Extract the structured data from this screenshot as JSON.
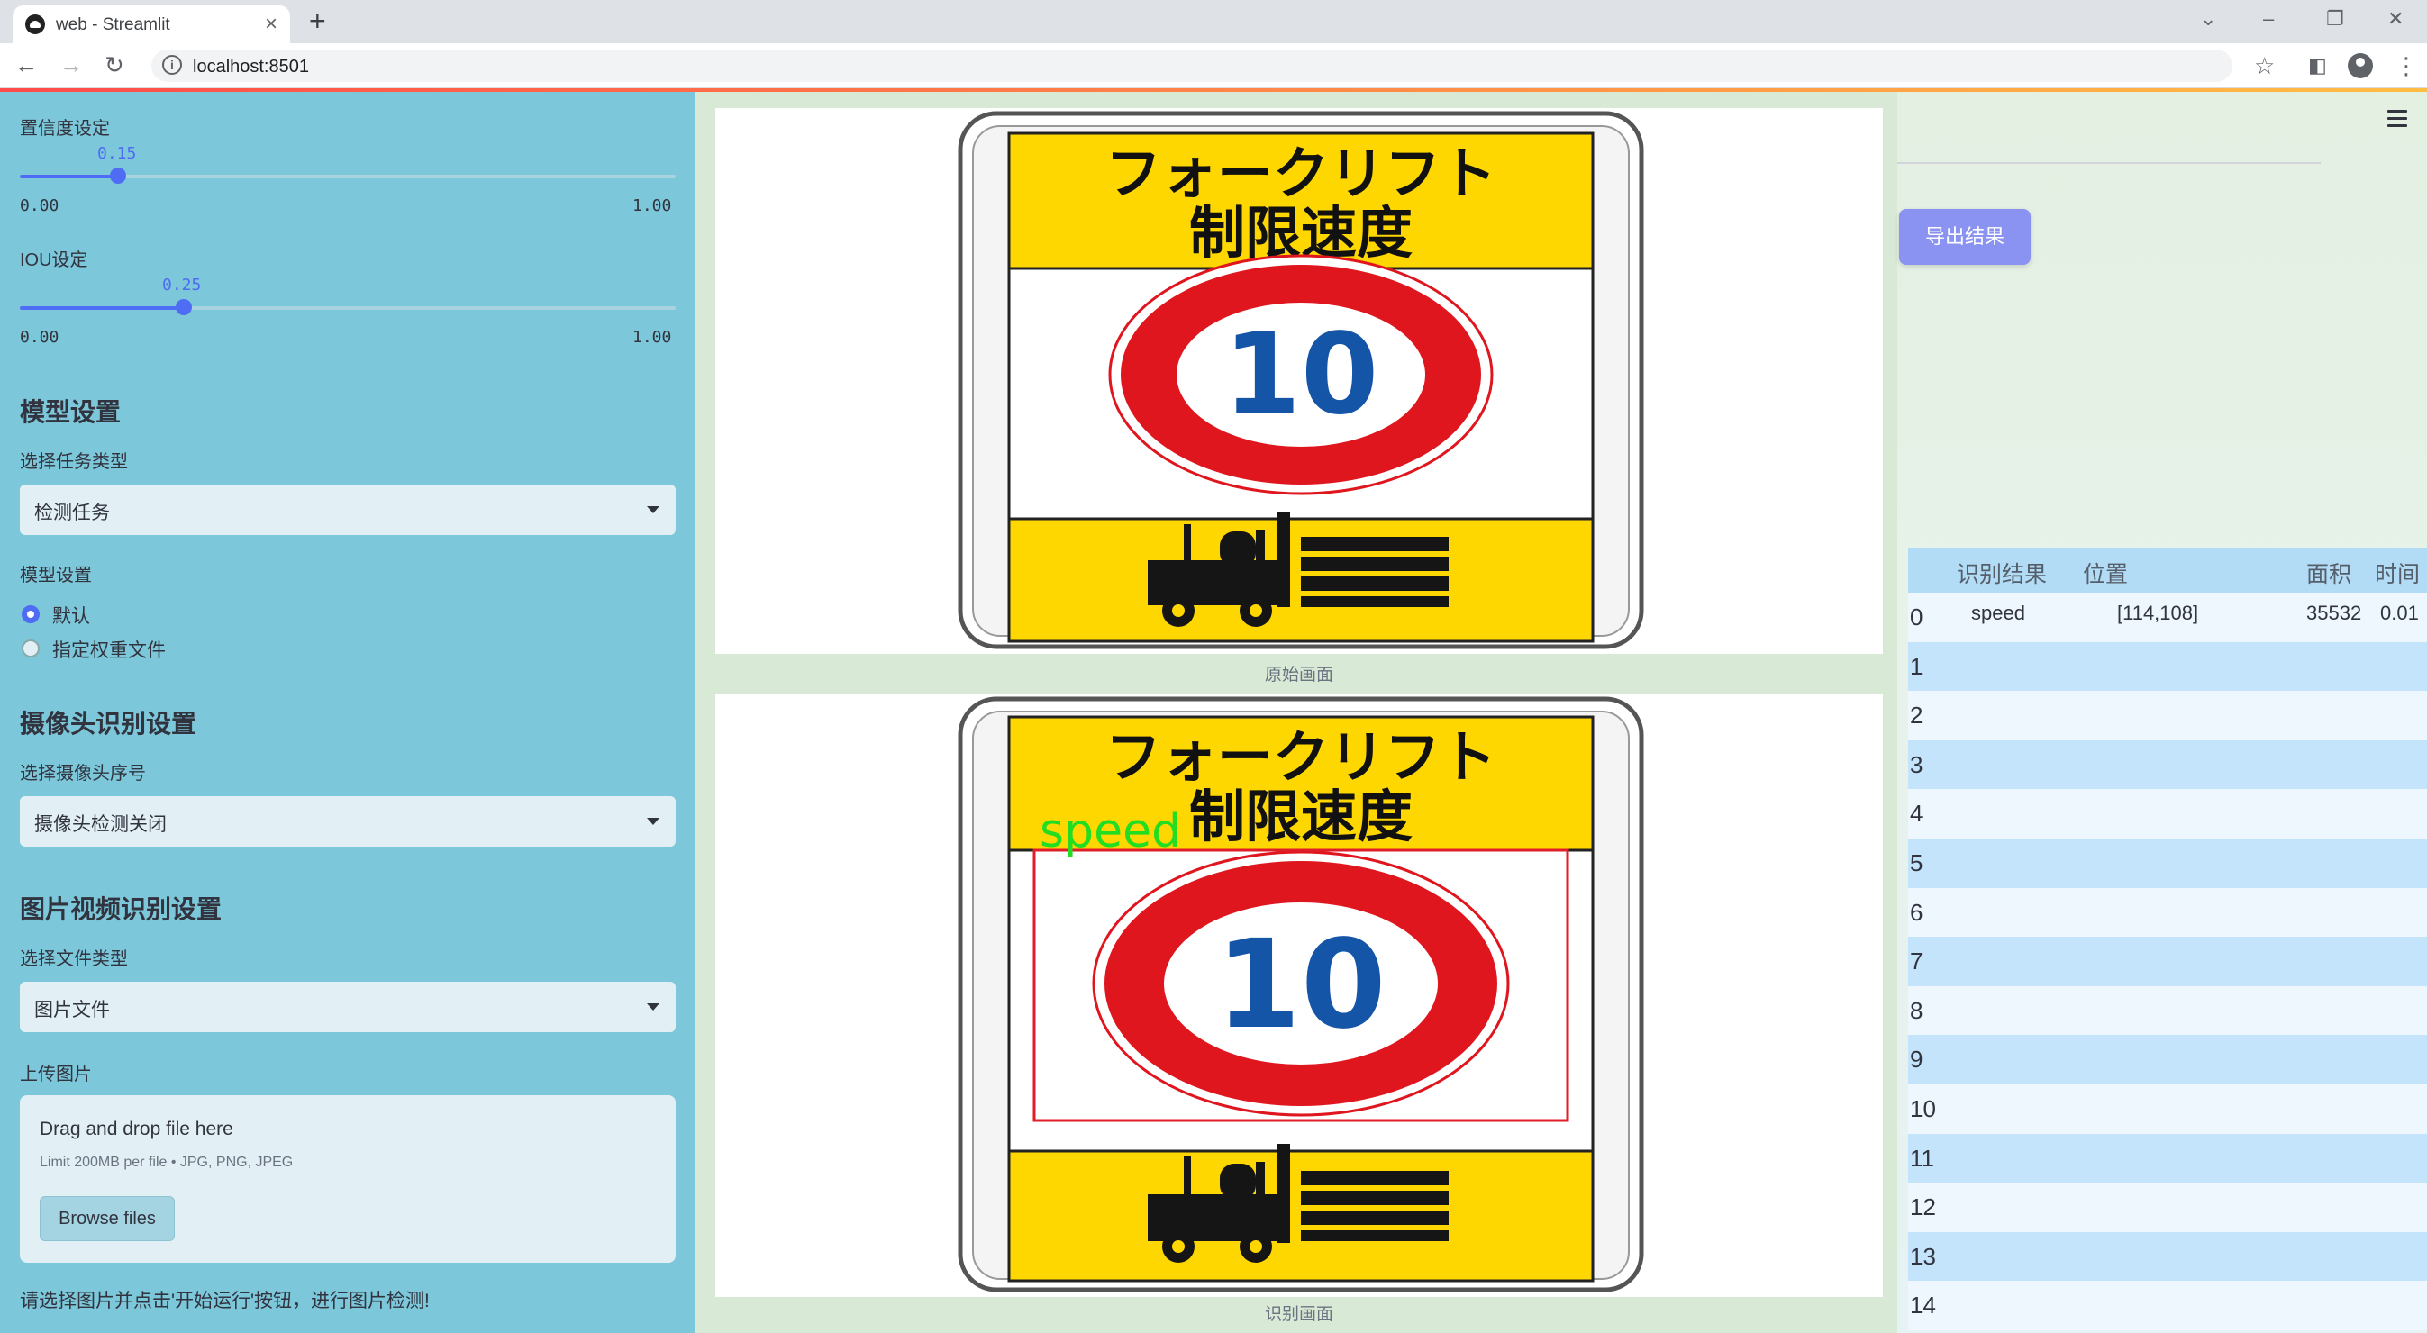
{
  "browser": {
    "tab_title": "web - Streamlit",
    "url": "localhost:8501"
  },
  "sidebar": {
    "confidence_label": "置信度设定",
    "confidence_value": "0.15",
    "confidence_min": "0.00",
    "confidence_max": "1.00",
    "confidence_fraction": 0.15,
    "iou_label": "IOU设定",
    "iou_value": "0.25",
    "iou_min": "0.00",
    "iou_max": "1.00",
    "iou_fraction": 0.25,
    "model_header": "模型设置",
    "task_label": "选择任务类型",
    "task_value": "检测任务",
    "model_label": "模型设置",
    "radio_default": "默认",
    "radio_custom": "指定权重文件",
    "camera_header": "摄像头识别设置",
    "camera_label": "选择摄像头序号",
    "camera_value": "摄像头检测关闭",
    "file_header": "图片视频识别设置",
    "filetype_label": "选择文件类型",
    "filetype_value": "图片文件",
    "upload_label": "上传图片",
    "upload_title": "Drag and drop file here",
    "upload_limit": "Limit 200MB per file • JPG, PNG, JPEG",
    "browse_label": "Browse files",
    "hint": "请选择图片并点击'开始运行'按钮，进行图片检测!"
  },
  "main": {
    "sign_line1": "フォークリフト",
    "sign_line2": "制限速度",
    "sign_number": "10",
    "caption_original": "原始画面",
    "caption_result": "识别画面",
    "detection_label": "speed"
  },
  "right": {
    "export_label": "导出结果",
    "table": {
      "headers": [
        "识别结果",
        "位置",
        "面积",
        "时间"
      ],
      "rows": [
        {
          "idx": "0",
          "result": "speed",
          "pos": "[114,108]",
          "area": "35532",
          "time": "0.01"
        },
        {
          "idx": "1",
          "result": "",
          "pos": "",
          "area": "",
          "time": ""
        },
        {
          "idx": "2",
          "result": "",
          "pos": "",
          "area": "",
          "time": ""
        },
        {
          "idx": "3",
          "result": "",
          "pos": "",
          "area": "",
          "time": ""
        },
        {
          "idx": "4",
          "result": "",
          "pos": "",
          "area": "",
          "time": ""
        },
        {
          "idx": "5",
          "result": "",
          "pos": "",
          "area": "",
          "time": ""
        },
        {
          "idx": "6",
          "result": "",
          "pos": "",
          "area": "",
          "time": ""
        },
        {
          "idx": "7",
          "result": "",
          "pos": "",
          "area": "",
          "time": ""
        },
        {
          "idx": "8",
          "result": "",
          "pos": "",
          "area": "",
          "time": ""
        },
        {
          "idx": "9",
          "result": "",
          "pos": "",
          "area": "",
          "time": ""
        },
        {
          "idx": "10",
          "result": "",
          "pos": "",
          "area": "",
          "time": ""
        },
        {
          "idx": "11",
          "result": "",
          "pos": "",
          "area": "",
          "time": ""
        },
        {
          "idx": "12",
          "result": "",
          "pos": "",
          "area": "",
          "time": ""
        },
        {
          "idx": "13",
          "result": "",
          "pos": "",
          "area": "",
          "time": ""
        },
        {
          "idx": "14",
          "result": "",
          "pos": "",
          "area": "",
          "time": ""
        }
      ]
    }
  },
  "colors": {
    "sidebar_bg": "#7cc7d9",
    "accent": "#4f6cf5",
    "export_button": "#8a93f2",
    "sign_yellow": "#ffd700",
    "sign_red": "#e0161f",
    "sign_blue": "#1555a8",
    "detection_green": "#22dd22",
    "detection_box": "#e01e2a"
  }
}
